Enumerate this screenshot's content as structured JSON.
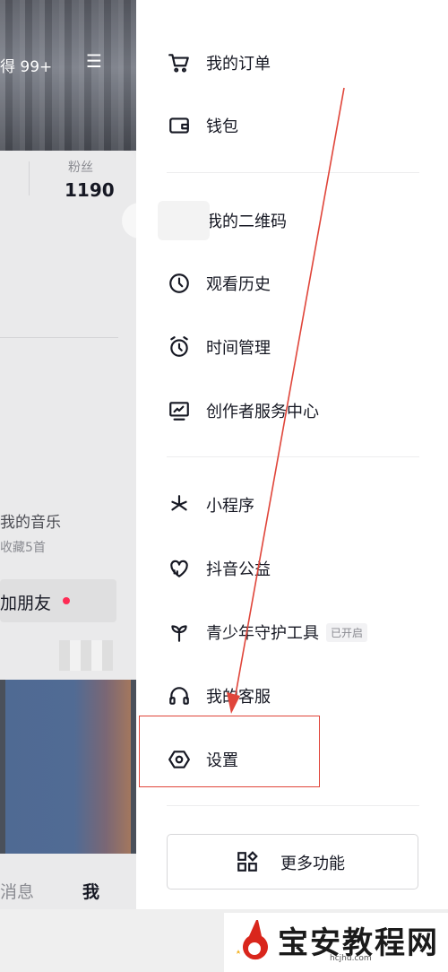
{
  "colors": {
    "drawer_bg": "#ffffff",
    "text_primary": "#161823",
    "text_secondary": "#8a8b91",
    "accent_red": "#fe2c55",
    "annotation": "#e0453a"
  },
  "left_panel": {
    "banner_text": "得 99+",
    "fans_label": "粉丝",
    "fans_count": "1190",
    "music_title": "我的音乐",
    "music_sub": "收藏5首",
    "add_friend_label": "加朋友",
    "tab_messages": "消息",
    "tab_me": "我"
  },
  "menu": {
    "items": [
      {
        "label": "我的订单",
        "icon": "cart-icon"
      },
      {
        "label": "钱包",
        "icon": "wallet-icon"
      },
      {
        "label": "我的二维码",
        "icon": "qrcode-icon"
      },
      {
        "label": "观看历史",
        "icon": "clock-icon"
      },
      {
        "label": "时间管理",
        "icon": "alarm-clock-icon"
      },
      {
        "label": "创作者服务中心",
        "icon": "monitor-chart-icon"
      },
      {
        "label": "小程序",
        "icon": "asterisk-icon"
      },
      {
        "label": "抖音公益",
        "icon": "heart-hands-icon"
      },
      {
        "label": "青少年守护工具",
        "icon": "sprout-icon",
        "badge": "已开启"
      },
      {
        "label": "我的客服",
        "icon": "headset-icon"
      },
      {
        "label": "设置",
        "icon": "hexagon-gear-icon"
      }
    ],
    "more_button": "更多功能"
  },
  "watermark": {
    "title": "宝安教程网",
    "url": "hcjhd.com"
  }
}
